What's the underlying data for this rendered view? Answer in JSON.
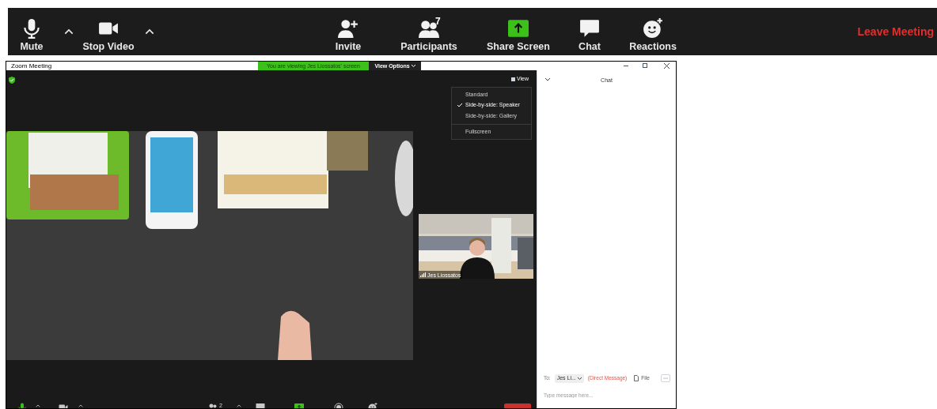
{
  "toolbar": {
    "items": [
      {
        "kind": "mic",
        "label": "Mute"
      },
      {
        "kind": "caret"
      },
      {
        "kind": "video",
        "label": "Stop Video"
      },
      {
        "kind": "caret"
      },
      {
        "kind": "invite",
        "label": "Invite"
      },
      {
        "kind": "participants",
        "label": "Participants",
        "count": "7"
      },
      {
        "kind": "share",
        "label": "Share Screen"
      },
      {
        "kind": "chat",
        "label": "Chat"
      },
      {
        "kind": "reactions",
        "label": "Reactions"
      }
    ],
    "leave": "Leave Meeting"
  },
  "window": {
    "title": "Zoom Meeting",
    "banner": "You are viewing Jes Liossatos' screen",
    "view_options": "View Options"
  },
  "meeting": {
    "view_button": "View",
    "view_menu": [
      {
        "label": "Standard",
        "selected": false,
        "divider_before": false
      },
      {
        "label": "Side-by-side: Speaker",
        "selected": true,
        "divider_before": false
      },
      {
        "label": "Side-by-side: Gallery",
        "selected": false,
        "divider_before": false
      },
      {
        "label": "Fullscreen",
        "selected": false,
        "divider_before": true
      }
    ],
    "thumbnail": {
      "name": "Jes Liossatos"
    },
    "bottom_bar": [
      {
        "kind": "mic"
      },
      {
        "kind": "caret"
      },
      {
        "kind": "video"
      },
      {
        "kind": "caret"
      },
      {
        "kind": "participants",
        "count": "2"
      },
      {
        "kind": "caret"
      },
      {
        "kind": "chat"
      },
      {
        "kind": "share"
      },
      {
        "kind": "record"
      },
      {
        "kind": "reactions"
      },
      {
        "kind": "leave"
      }
    ]
  },
  "chat": {
    "title": "Chat",
    "to_label": "To:",
    "recipient": "Jes Li...",
    "direct_message": "(Direct Message)",
    "file": "File",
    "placeholder": "Type message here..."
  }
}
